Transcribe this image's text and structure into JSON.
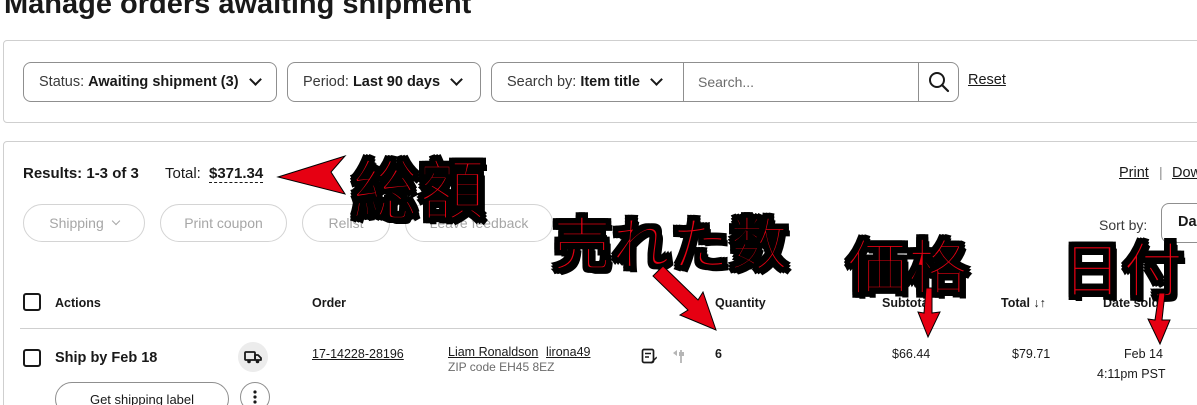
{
  "page": {
    "title": "Manage orders awaiting shipment"
  },
  "filters": {
    "status": {
      "label": "Status:",
      "value": "Awaiting shipment (3)"
    },
    "period": {
      "label": "Period:",
      "value": "Last 90 days"
    },
    "search_by": {
      "label": "Search by:",
      "value": "Item title"
    },
    "search_placeholder": "Search...",
    "reset_label": "Reset"
  },
  "results": {
    "count_label": "Results: 1-3 of 3",
    "total_label": "Total:",
    "total_value": "$371.34",
    "print_label": "Print",
    "separator": "|",
    "download_label": "Dow"
  },
  "action_buttons": {
    "shipping": "Shipping",
    "print_coupon": "Print coupon",
    "relist": "Relist",
    "leave_feedback": "Leave feedback"
  },
  "sort": {
    "label": "Sort by:",
    "value": "Da"
  },
  "table": {
    "headers": {
      "actions": "Actions",
      "order": "Order",
      "quantity": "Quantity",
      "subtotal": "Subtotal",
      "total": "Total",
      "total_sort_icon": "↓↑",
      "date_sold": "Date sold"
    },
    "rows": [
      {
        "ship_by": "Ship by Feb 18",
        "order_number": "17-14228-28196",
        "buyer_name": "Liam Ronaldson",
        "buyer_id": "lirona49",
        "zip": "ZIP code EH45 8EZ",
        "quantity": "6",
        "subtotal": "$66.44",
        "total": "$79.71",
        "date_sold": "Feb 14",
        "time_sold": "4:11pm PST",
        "shipping_label_button": "Get shipping label"
      }
    ]
  },
  "annotations": {
    "total_amount": "総額",
    "quantity_sold": "売れた数",
    "price": "価格",
    "date": "日付",
    "color": "#e60012"
  },
  "icons": {
    "search": "search-icon",
    "truck": "truck-icon",
    "more": "more-vertical-icon",
    "note": "note-edit-icon",
    "flag": "flag-icon"
  }
}
